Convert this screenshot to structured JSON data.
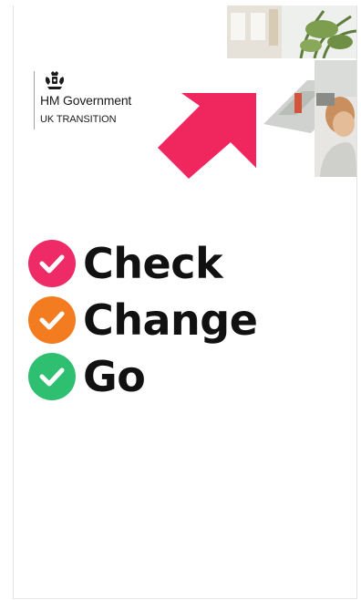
{
  "brand": {
    "title": "HM Government",
    "subtitle": "UK TRANSITION"
  },
  "colors": {
    "arrow": "#f0275e",
    "check": "#ee2a67",
    "change": "#f47c20",
    "go": "#2fbf71"
  },
  "icons": {
    "crest": "royal-coat-of-arms-icon",
    "arrow": "up-right-arrow-icon",
    "tick": "checkmark-icon"
  },
  "checklist": [
    {
      "label": "Check"
    },
    {
      "label": "Change"
    },
    {
      "label": "Go"
    }
  ]
}
